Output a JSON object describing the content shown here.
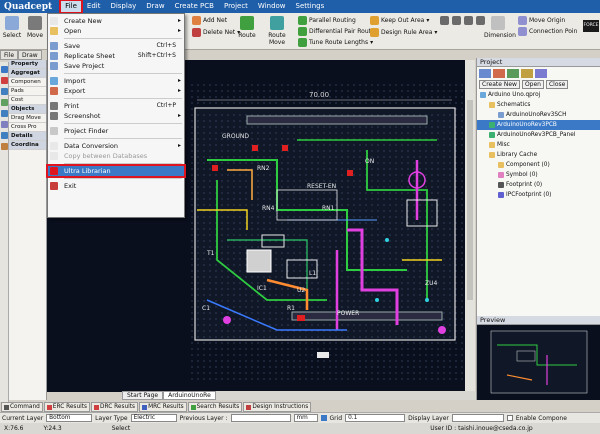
{
  "app": {
    "logo": "Quadcept"
  },
  "menubar": [
    "File",
    "Edit",
    "Display",
    "Draw",
    "Create PCB",
    "Project",
    "Window",
    "Settings"
  ],
  "toolbar": {
    "select": "Select",
    "move": "Move",
    "add_net": "Add Net",
    "delete_net": "Delete Net",
    "route": "Route",
    "route_move": "Route Move",
    "parallel_routing": "Parallel Routing",
    "differential_pair": "Differential Pair Routes",
    "tune_route_lengths": "Tune Route Lengths",
    "keep_out_area": "Keep Out Area",
    "design_rule_area": "Design Rule Area",
    "dimension": "Dimension",
    "move_origin": "Move Origin",
    "connection_point": "Connection Poin",
    "force": "FORCE"
  },
  "left_tabs": [
    "File",
    "Draw"
  ],
  "property_panel": {
    "title": "Property",
    "sections": [
      "Aggregat",
      "Componen",
      "Pads",
      "Cost",
      "Objects",
      "Drag Move",
      "Cross Pro",
      "Details",
      "Coordina"
    ]
  },
  "file_menu": {
    "items": [
      {
        "label": "Create New",
        "shortcut": "",
        "arrow": true,
        "color": "#e8e8e8"
      },
      {
        "label": "Open",
        "shortcut": "",
        "arrow": true,
        "color": "#e8c060"
      },
      {
        "sep": true
      },
      {
        "label": "Save",
        "shortcut": "Ctrl+S",
        "color": "#7a9ccf"
      },
      {
        "label": "Replicate Sheet",
        "shortcut": "Shift+Ctrl+S",
        "color": "#7a9ccf"
      },
      {
        "label": "Save Project",
        "shortcut": "",
        "color": "#7a9ccf"
      },
      {
        "sep": true
      },
      {
        "label": "Import",
        "shortcut": "",
        "arrow": true,
        "color": "#6aa8dc"
      },
      {
        "label": "Export",
        "shortcut": "",
        "arrow": true,
        "color": "#d06a4a"
      },
      {
        "sep": true
      },
      {
        "label": "Print",
        "shortcut": "Ctrl+P",
        "color": "#777777"
      },
      {
        "label": "Screenshot",
        "shortcut": "",
        "arrow": true,
        "color": "#777777"
      },
      {
        "sep": true
      },
      {
        "label": "Project Finder",
        "shortcut": "",
        "color": "#c8c8c8"
      },
      {
        "sep": true
      },
      {
        "label": "Data Conversion",
        "shortcut": "",
        "arrow": true,
        "color": "#e8e8e8"
      },
      {
        "label": "Copy between Databases",
        "shortcut": "",
        "disabled": true,
        "color": "#e8e8e8"
      },
      {
        "sep": true
      },
      {
        "label": "Ultra Librarian",
        "shortcut": "",
        "highlight": true,
        "color": "#e0141e"
      },
      {
        "sep": true
      },
      {
        "label": "Exit",
        "shortcut": "",
        "color": "#c83c3c"
      }
    ]
  },
  "project_panel": {
    "title": "Project",
    "buttons": [
      "Create New",
      "Open",
      "Close"
    ],
    "tree": [
      {
        "label": "Arduino Uno.qproj",
        "indent": 0,
        "color": "#6aa8dc"
      },
      {
        "label": "Schematics",
        "indent": 1,
        "color": "#e8c060"
      },
      {
        "label": "ArduinoUnoRev3SCH",
        "indent": 2,
        "color": "#7a9ccf"
      },
      {
        "label": "ArduinoUnoRev3PCB",
        "indent": 1,
        "color": "#3bb070",
        "selected": true
      },
      {
        "label": "ArduinoUnoRev3PCB_Panel",
        "indent": 1,
        "color": "#3bb070"
      },
      {
        "label": "Misc",
        "indent": 1,
        "color": "#e8c060"
      },
      {
        "label": "Library Cache",
        "indent": 1,
        "color": "#e8c060"
      },
      {
        "label": "Component (0)",
        "indent": 2,
        "color": "#e8c060"
      },
      {
        "label": "Symbol (0)",
        "indent": 2,
        "color": "#e080c0"
      },
      {
        "label": "Footprint (0)",
        "indent": 2,
        "color": "#555555"
      },
      {
        "label": "IPCFootprint (0)",
        "indent": 2,
        "color": "#6060d0"
      }
    ]
  },
  "preview": {
    "title": "Preview"
  },
  "doc_tabs": [
    "Start Page",
    "ArduinoUnoRe"
  ],
  "bottom_tabs": [
    "Command",
    "ERC Results",
    "DRC Results",
    "MRC Results",
    "Search Results",
    "Design Instructions"
  ],
  "status": {
    "current_layer_label": "Current Layer",
    "current_layer": "Bottom",
    "layer_type_label": "Layer Type",
    "layer_type": "Electric",
    "previous_layer_label": "Previous Layer :",
    "unit": "mm",
    "grid_label": "Grid",
    "grid": "0.1",
    "display_layer_label": "Display Layer",
    "enable_component": "Enable Compone"
  },
  "coords": {
    "x": "X:76.6",
    "y": "Y:24.3",
    "select": "Select",
    "user_id": "User ID :  taishi.inoue@cseda.co.jp"
  },
  "board_labels": {
    "dim": "70.00",
    "gnd": "GROUND",
    "reset": "RESET-EN",
    "on": "ON",
    "rn1": "RN1",
    "rn2": "RN2",
    "rn4": "RN4",
    "power": "POWER",
    "ic1": "IC1",
    "r1": "R1",
    "l1": "L1",
    "u2": "U2",
    "t1": "T1",
    "c1": "C1",
    "zu4": "ZU4"
  },
  "colors": {
    "menubar": "#1f5ea8",
    "highlight": "#e0141e",
    "select_blue": "#3b79c6"
  }
}
